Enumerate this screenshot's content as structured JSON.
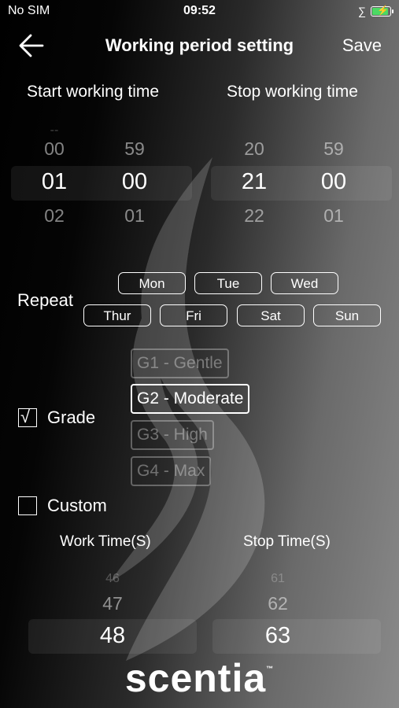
{
  "status_bar": {
    "carrier": "No SIM",
    "time": "09:52",
    "bluetooth_icon": "bluetooth-icon",
    "battery_icon": "battery-charging-icon",
    "battery_level": 0.85
  },
  "nav": {
    "title": "Working period setting",
    "save_label": "Save",
    "back_icon": "arrow-left-icon"
  },
  "start": {
    "label": "Start working time",
    "hours": [
      "00",
      "01",
      "02"
    ],
    "minutes": [
      "59",
      "00",
      "01"
    ]
  },
  "stop": {
    "label": "Stop working time",
    "hours": [
      "20",
      "21",
      "22"
    ],
    "minutes": [
      "59",
      "00",
      "01"
    ]
  },
  "repeat": {
    "label": "Repeat",
    "days": [
      "Mon",
      "Tue",
      "Wed",
      "Thur",
      "Fri",
      "Sat",
      "Sun"
    ]
  },
  "grade": {
    "label": "Grade",
    "checked": true,
    "check_mark": "√",
    "options": [
      "G1 - Gentle",
      "G2 - Moderate",
      "G3 - High",
      "G4 - Max"
    ],
    "selected": "G2 - Moderate"
  },
  "custom": {
    "label": "Custom",
    "checked": false,
    "work_label": "Work Time(S)",
    "stop_label": "Stop Time(S)",
    "work_values": [
      "46",
      "47",
      "48"
    ],
    "stop_values": [
      "61",
      "62",
      "63"
    ]
  },
  "brand": {
    "name": "scentia",
    "tm": "™"
  }
}
